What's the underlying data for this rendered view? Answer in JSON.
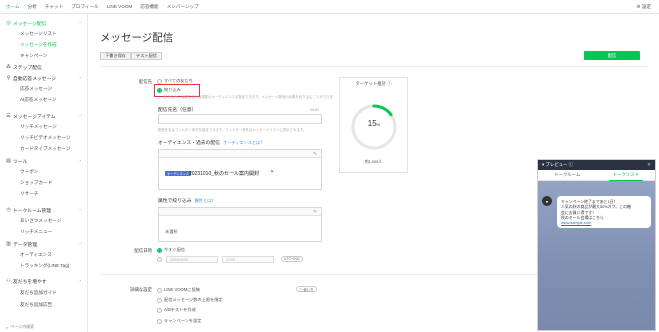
{
  "topnav": {
    "items": [
      "ホーム",
      "分析",
      "チャット",
      "プロフィール",
      "LINE VOOM",
      "応答機能",
      "メンバーシップ"
    ],
    "active_index": 0,
    "settings": "⚙ 設定"
  },
  "sidebar": {
    "groups": [
      {
        "label": "メッセージ配信",
        "icon": "message-icon",
        "items": [
          "メッセージリスト",
          "メッセージを作成",
          "キャンペーン"
        ]
      },
      {
        "label": "ステップ配信",
        "icon": "step-icon",
        "items": []
      },
      {
        "label": "自動応答メッセージ",
        "icon": "auto-reply-icon",
        "items": [
          "応答メッセージ",
          "AI応答メッセージ"
        ]
      },
      {
        "label": "メッセージアイテム",
        "icon": "item-icon",
        "items": [
          "リッチメッセージ",
          "リッチビデオメッセージ",
          "カードタイプメッセージ"
        ]
      },
      {
        "label": "ツール",
        "icon": "tool-icon",
        "items": [
          "クーポン",
          "ショップカード",
          "リサーチ"
        ]
      },
      {
        "label": "トークルーム管理",
        "icon": "talkroom-icon",
        "items": [
          "あいさつメッセージ",
          "リッチメニュー"
        ]
      },
      {
        "label": "データ管理",
        "icon": "data-icon",
        "items": [
          "オーディエンス",
          "トラッキング(LINE Tag)"
        ]
      },
      {
        "label": "友だちを増やす",
        "icon": "friends-icon",
        "items": [
          "友だち追加ガイド",
          "友だち追加広告"
        ]
      }
    ],
    "footer": "ページ内検索"
  },
  "main": {
    "title": "メッセージ配信",
    "btn_draft": "下書き保存",
    "btn_test": "テスト配信",
    "btn_send": "配信",
    "recipients_label": "配信先",
    "radio_all": "すべての友だち",
    "radio_filter": "絞り込み",
    "filter_hint": "絞り込みには属性または複数のオーディエンスを指定できます。メッセージ配信の対象を絞り込むことができます",
    "message_name_label": "配信先名（任意）",
    "char_count": "0/100",
    "name_hint": "配信先名はフィルター条件を設定できます。フィルター条件はメッセージリストに表示されます。",
    "audience_label": "オーディエンス・過去の配信",
    "audience_link": "オーディエンスとは？",
    "audience_tag": "オーディエンス",
    "audience_name": "20231010_秋のセール案内開封",
    "attr_label": "属性で絞り込み",
    "attr_link": "属性とは？",
    "attr_value": "未選択",
    "schedule_label": "配信日時",
    "radio_now": "今すぐ配信",
    "date_placeholder": "2023/10/30",
    "time_placeholder": "17:00",
    "timezone": "UTC+9:00",
    "advanced_label": "詳細な設定",
    "adv_options": [
      "LINE VOOMに投稿",
      "配信メッセージ数の上限を指定",
      "A/Bテストを作成",
      "キャンペーンを設定"
    ],
    "usage_btn": "ⓘ 使い方"
  },
  "target": {
    "title": "ターゲット推計 ⓘ",
    "value": "15",
    "unit": "%",
    "percent": 15,
    "sub": "約1,000人"
  },
  "preview": {
    "title": "▾ プレビュー ⓘ",
    "close": "✕",
    "tabs": [
      "トークルーム",
      "トークリスト"
    ],
    "active_tab": 1,
    "bubble_lines": [
      "キャンペーン終了まであと1日！",
      "人気の秋の商品が最大50%オフ。この機",
      "会にお買い得です！",
      "秋のセール会場はこちら",
      "www.sample.com"
    ],
    "accent": "#06c755"
  },
  "colors": {
    "accent": "#06c755",
    "link": "#4a90e2",
    "highlight_box": "#e8333a"
  }
}
